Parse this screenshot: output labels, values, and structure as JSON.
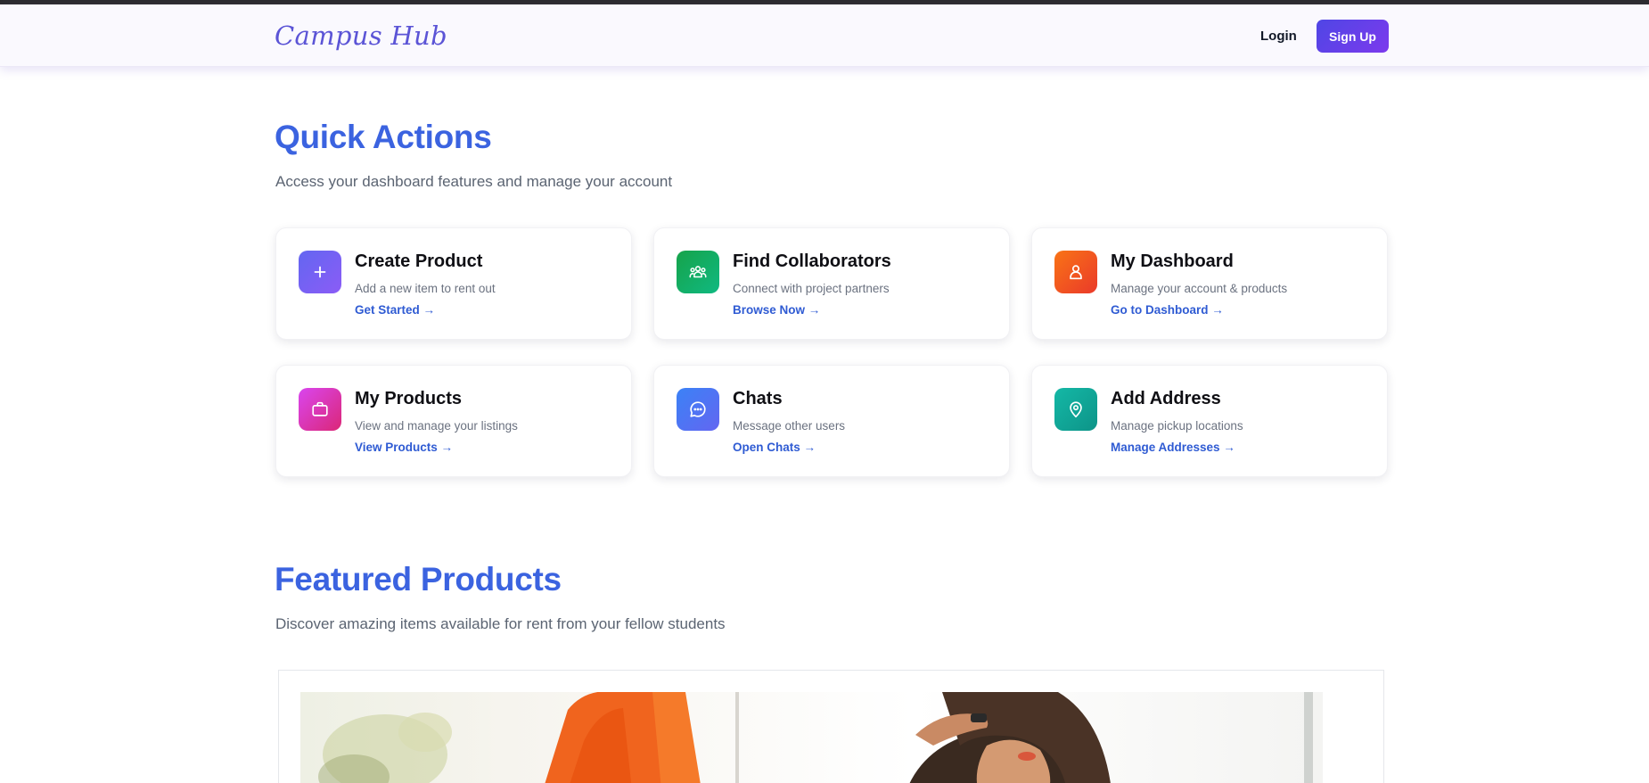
{
  "header": {
    "brand": "Campus Hub",
    "login_label": "Login",
    "signup_label": "Sign Up"
  },
  "quick_actions": {
    "title": "Quick Actions",
    "subtitle": "Access your dashboard features and manage your account",
    "cards": [
      {
        "title": "Create Product",
        "description": "Add a new item to rent out",
        "link": "Get Started →",
        "icon": "plus-icon",
        "gradient": [
          "#6366f1",
          "#8b5cf6"
        ]
      },
      {
        "title": "Find Collaborators",
        "description": "Connect with project partners",
        "link": "Browse Now →",
        "icon": "users-icon",
        "gradient": [
          "#16a34a",
          "#10b981"
        ]
      },
      {
        "title": "My Dashboard",
        "description": "Manage your account & products",
        "link": "Go to Dashboard →",
        "icon": "user-icon",
        "gradient": [
          "#f97316",
          "#ea3a2a"
        ]
      },
      {
        "title": "My Products",
        "description": "View and manage your listings",
        "link": "View Products →",
        "icon": "briefcase-icon",
        "gradient": [
          "#d946ef",
          "#db2777"
        ]
      },
      {
        "title": "Chats",
        "description": "Message other users",
        "link": "Open Chats →",
        "icon": "chat-bubble-icon",
        "gradient": [
          "#3b82f6",
          "#6366f1"
        ]
      },
      {
        "title": "Add Address",
        "description": "Manage pickup locations",
        "link": "Manage Addresses →",
        "icon": "map-pin-icon",
        "gradient": [
          "#14b8a6",
          "#0d9488"
        ]
      }
    ]
  },
  "featured": {
    "title": "Featured Products",
    "subtitle": "Discover amazing items available for rent from your fellow students"
  },
  "colors": {
    "accent_title": "#3b63e0",
    "link": "#2f5bd3",
    "signup_gradient": [
      "#4f46e5",
      "#7c3aed"
    ]
  }
}
